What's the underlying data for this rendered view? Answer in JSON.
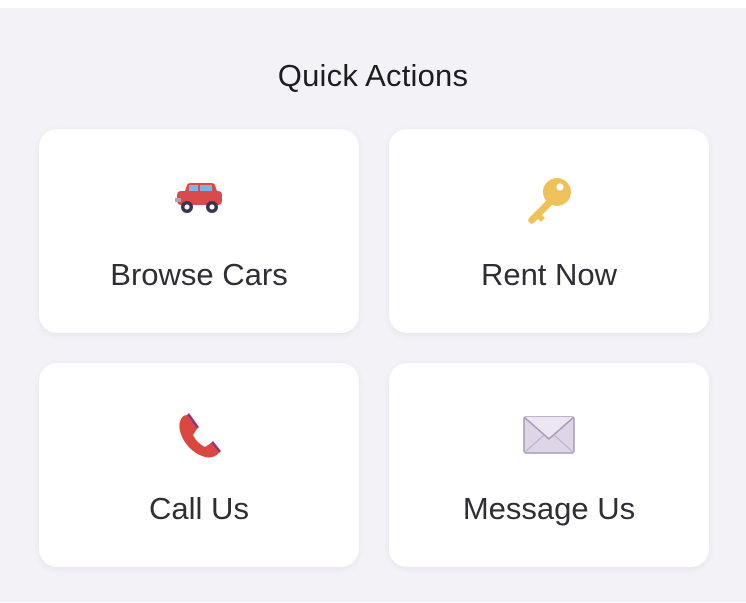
{
  "section": {
    "title": "Quick Actions"
  },
  "actions": [
    {
      "label": "Browse Cars",
      "icon": "car-icon"
    },
    {
      "label": "Rent Now",
      "icon": "key-icon"
    },
    {
      "label": "Call Us",
      "icon": "phone-icon"
    },
    {
      "label": "Message Us",
      "icon": "envelope-icon"
    }
  ],
  "colors": {
    "background": "#f3f2f7",
    "card": "#ffffff",
    "text": "#2e2e33",
    "car_body": "#d94b4b",
    "key": "#eec15a",
    "phone": "#d9473f",
    "envelope": "#ddd6e6"
  }
}
